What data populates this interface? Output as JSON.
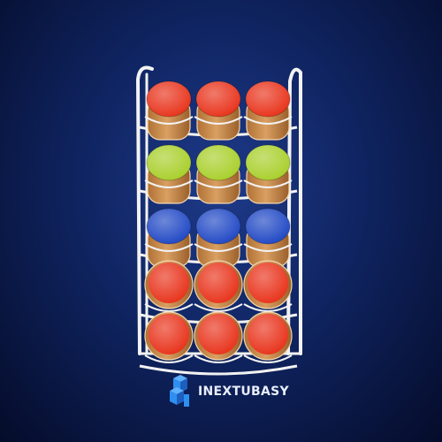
{
  "brand": {
    "name": "INEXTUBASY",
    "logo_icon": "blue-cubes-logo",
    "logo_color": "#2f8ff0"
  },
  "scene": {
    "background_top": "#1e3a8a",
    "background_bottom": "#050c2a",
    "rack_color": "#f2f2f2",
    "jar_body_color": "#c98a4a",
    "rows": [
      {
        "lid_color": "#e8321a",
        "jars": 3
      },
      {
        "lid_color": "#a8cf2a",
        "jars": 3
      },
      {
        "lid_color": "#1f47c4",
        "jars": 3
      },
      {
        "lid_color": "#e8321a",
        "jars": 3
      },
      {
        "lid_color": "#e8321a",
        "jars": 3
      }
    ]
  }
}
